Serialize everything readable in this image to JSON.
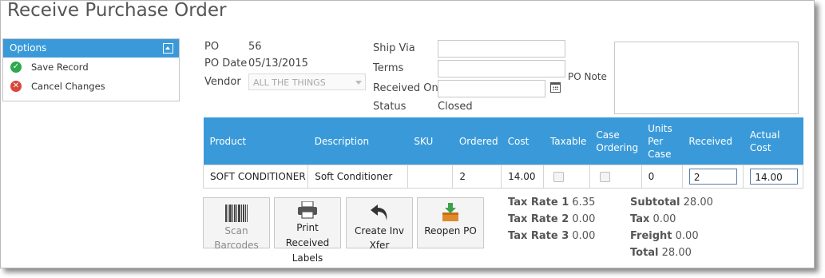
{
  "page": {
    "title": "Receive Purchase Order"
  },
  "options": {
    "header": "Options",
    "items": [
      {
        "label": "Save Record",
        "icon": "check-icon"
      },
      {
        "label": "Cancel Changes",
        "icon": "cancel-icon"
      }
    ]
  },
  "po": {
    "po_label": "PO",
    "po_value": "56",
    "date_label": "PO Date",
    "date_value": "05/13/2015",
    "vendor_label": "Vendor",
    "vendor_value": "ALL THE THINGS",
    "ship_via_label": "Ship Via",
    "ship_via_value": "",
    "terms_label": "Terms",
    "terms_value": "",
    "received_on_label": "Received On",
    "received_on_value": "",
    "status_label": "Status",
    "status_value": "Closed",
    "note_label": "PO Note",
    "note_value": ""
  },
  "table": {
    "headers": [
      "Product",
      "Description",
      "SKU",
      "Ordered",
      "Cost",
      "Taxable",
      "Case Ordering",
      "Units Per Case",
      "Received",
      "Actual Cost"
    ],
    "rows": [
      {
        "product": "SOFT CONDITIONER",
        "description": "Soft Conditioner",
        "sku": "",
        "ordered": "2",
        "cost": "14.00",
        "taxable": false,
        "case_ordering": false,
        "units_per_case": "0",
        "received": "2",
        "actual_cost": "14.00"
      }
    ]
  },
  "buttons": {
    "scan": "Scan Barcodes",
    "print": "Print Received Labels",
    "xfer": "Create Inv Xfer",
    "reopen": "Reopen PO"
  },
  "taxes": {
    "rate1_label": "Tax Rate 1",
    "rate1_value": "6.35",
    "rate2_label": "Tax Rate 2",
    "rate2_value": "0.00",
    "rate3_label": "Tax Rate 3",
    "rate3_value": "0.00"
  },
  "totals": {
    "subtotal_label": "Subtotal",
    "subtotal_value": "28.00",
    "tax_label": "Tax",
    "tax_value": "0.00",
    "freight_label": "Freight",
    "freight_value": "0.00",
    "total_label": "Total",
    "total_value": "28.00"
  },
  "colors": {
    "accent": "#3a9ad9",
    "save": "#2ea84d",
    "cancel": "#d9473c"
  }
}
